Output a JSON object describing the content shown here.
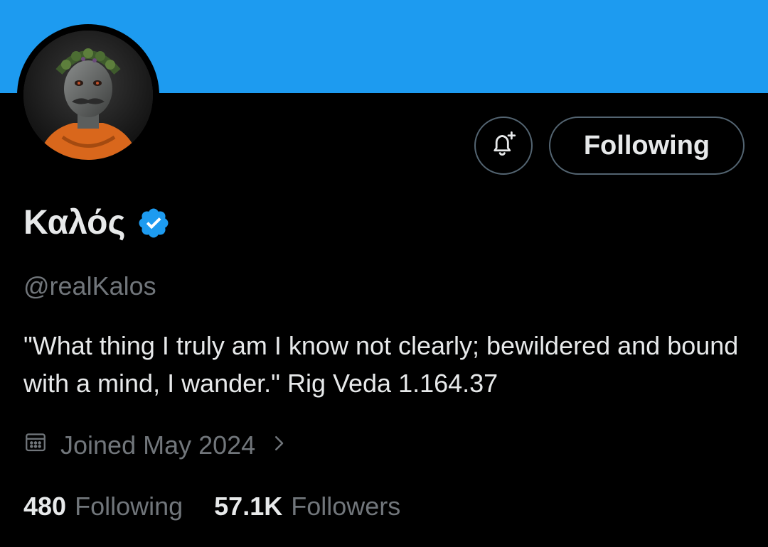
{
  "profile": {
    "display_name": "Καλός",
    "handle": "@realKalos",
    "bio": "\"What thing I truly am I know not clearly; bewildered and bound with a mind, I wander.\" Rig Veda 1.164.37",
    "joined": "Joined May 2024",
    "verified": true
  },
  "actions": {
    "notify_icon": "bell-plus-icon",
    "following_label": "Following"
  },
  "stats": {
    "following_count": "480",
    "following_label": "Following",
    "followers_count": "57.1K",
    "followers_label": "Followers"
  },
  "colors": {
    "banner": "#1d9bf0",
    "background": "#000000",
    "primary_text": "#e7e9ea",
    "secondary_text": "#71767b",
    "verified_badge": "#1d9bf0",
    "button_border": "#536471"
  }
}
